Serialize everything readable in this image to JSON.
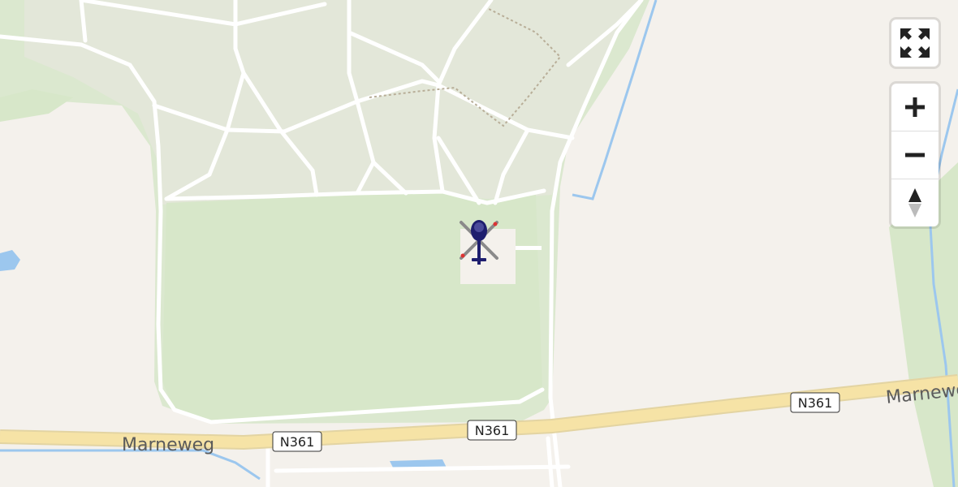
{
  "map": {
    "road_labels": [
      "Marneweg",
      "Marneweg"
    ],
    "route_shields": [
      "N361",
      "N361",
      "N361"
    ]
  },
  "colors": {
    "background": "#f4f1ec",
    "park": "#d9e9cc",
    "wooded": "#e2e7da",
    "road": "#ffffff",
    "main_road": "#f6e3a6",
    "water": "#9cc7ee",
    "helicopter": "#1e1e6e"
  },
  "marker": {
    "icon": "helicopter-icon"
  },
  "controls": {
    "fullscreen_icon": "fullscreen-icon",
    "zoom_in_icon": "zoom-in-icon",
    "zoom_out_icon": "zoom-out-icon",
    "compass_icon": "compass-icon"
  }
}
